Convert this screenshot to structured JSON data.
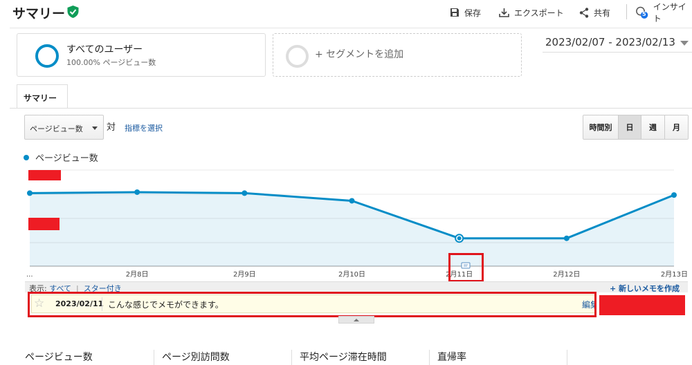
{
  "header": {
    "title": "サマリー",
    "save": "保存",
    "export": "エクスポート",
    "share": "共有",
    "insights": "インサイト",
    "insights_badge": "5"
  },
  "segments": {
    "primary_name": "すべてのユーザー",
    "primary_sub": "100.00% ページビュー数",
    "add_label": "+ セグメントを追加"
  },
  "date_range": "2023/02/07 - 2023/02/13",
  "tabs": [
    {
      "label": "サマリー",
      "active": true
    }
  ],
  "controls": {
    "metric": "ページビュー数",
    "vs": "対",
    "choose_metric": "指標を選択",
    "granularity": [
      "時間別",
      "日",
      "週",
      "月"
    ],
    "granularity_active": "日"
  },
  "chart_data": {
    "type": "area",
    "series": [
      {
        "name": "ページビュー数",
        "color": "#058dc7",
        "values": [
          76,
          77,
          76,
          68,
          29,
          29,
          74
        ]
      }
    ],
    "x": [
      "...",
      "2月8日",
      "2月9日",
      "2月10日",
      "2月11日",
      "2月12日",
      "2月13日"
    ],
    "ylim": [
      0,
      100
    ],
    "y_tick_labels_redacted": true,
    "annotated_point": "2月11日"
  },
  "notes": {
    "show_label": "表示:",
    "filter_all": "すべて",
    "filter_separator": "|",
    "filter_starred": "スター付き",
    "create": "+ 新しいメモを作成",
    "items": [
      {
        "date": "2023/02/11",
        "text": "こんな感じでメモができます。",
        "edit": "編集"
      }
    ]
  },
  "metrics": [
    "ページビュー数",
    "ページ別訪問数",
    "平均ページ滞在時間",
    "直帰率"
  ],
  "colors": {
    "accent": "#058dc7",
    "link": "#1a5aa0",
    "redaction": "#ee1c24",
    "note_bg": "#fffde7",
    "shield": "#0f9d58"
  }
}
